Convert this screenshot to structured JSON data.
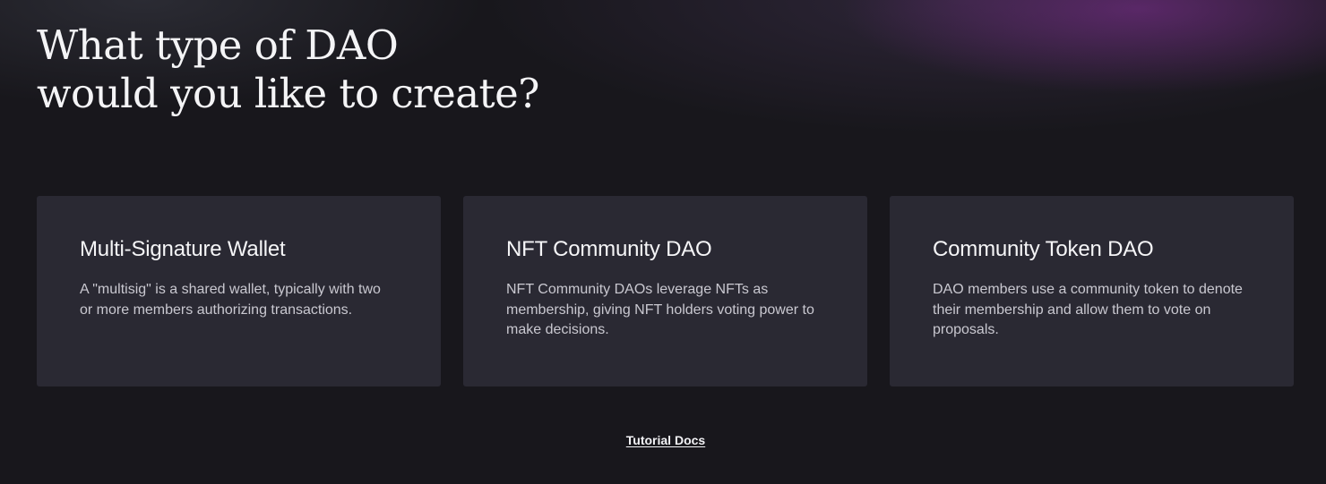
{
  "heading": {
    "line1": "What type of DAO",
    "line2": "would you like to create?"
  },
  "cards": [
    {
      "title": "Multi-Signature Wallet",
      "description": "A \"multisig\" is a shared wallet, typically with two or more members authorizing transactions."
    },
    {
      "title": "NFT Community DAO",
      "description": "NFT Community DAOs leverage NFTs as membership, giving NFT holders voting power to make decisions."
    },
    {
      "title": "Community Token DAO",
      "description": "DAO members use a community token to denote their membership and allow them to vote on proposals."
    }
  ],
  "footer": {
    "tutorial_link": "Tutorial Docs"
  },
  "colors": {
    "background": "#18171c",
    "card_background": "#2a2933",
    "glow_accent": "#842e96",
    "text_primary": "#f2f2f5",
    "text_secondary": "#c9c8d0"
  }
}
